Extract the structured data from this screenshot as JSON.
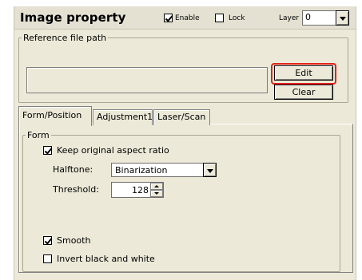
{
  "header": {
    "title": "Image property",
    "enable_label": "Enable",
    "enable_checked": true,
    "lock_label": "Lock",
    "lock_checked": false,
    "layer_label": "Layer",
    "layer_value": "0"
  },
  "reference": {
    "group_label": "Reference file path",
    "path_value": "",
    "edit_label": "Edit",
    "clear_label": "Clear",
    "highlight_color": "#e2231a"
  },
  "tabs": [
    {
      "label": "Form/Position",
      "active": true
    },
    {
      "label": "Adjustment1",
      "active": false
    },
    {
      "label": "Laser/Scan",
      "active": false
    }
  ],
  "form": {
    "group_label": "Form",
    "keep_aspect_label": "Keep original aspect ratio",
    "keep_aspect_checked": true,
    "halftone_label": "Halftone:",
    "halftone_value": "Binarization",
    "threshold_label": "Threshold:",
    "threshold_value": "128",
    "smooth_label": "Smooth",
    "smooth_checked": true,
    "invert_label": "Invert black and white",
    "invert_checked": false
  }
}
